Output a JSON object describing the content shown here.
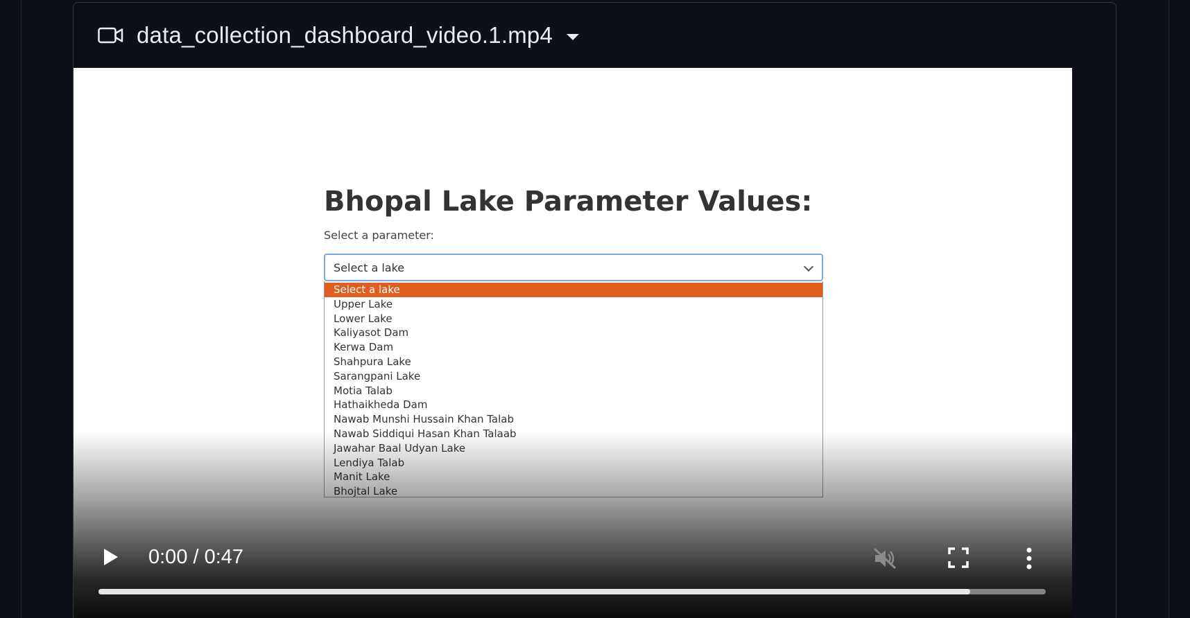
{
  "file": {
    "title": "data_collection_dashboard_video.1.mp4",
    "icon": "video-camera-icon"
  },
  "video_frame": {
    "heading": "Bhopal Lake Parameter Values:",
    "label": "Select a parameter:",
    "select": {
      "value": "Select a lake",
      "options": [
        "Select a lake",
        "Upper Lake",
        "Lower Lake",
        "Kaliyasot Dam",
        "Kerwa Dam",
        "Shahpura Lake",
        "Sarangpani Lake",
        "Motia Talab",
        "Hathaikheda Dam",
        "Nawab Munshi Hussain Khan Talab",
        "Nawab Siddiqui Hasan Khan Talaab",
        "Jawahar Baal Udyan Lake",
        "Lendiya Talab",
        "Manit Lake",
        "Bhojtal Lake"
      ],
      "highlight_color": "#e05d1f"
    }
  },
  "player": {
    "time": "0:00 / 0:47",
    "buffered_fraction": 0.92,
    "muted": true
  }
}
